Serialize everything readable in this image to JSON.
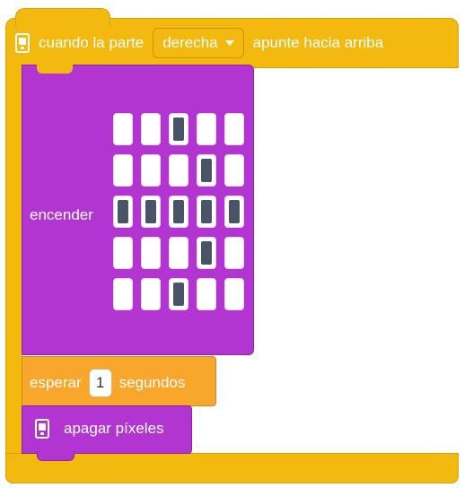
{
  "hat": {
    "label_prefix": "cuando la parte",
    "dropdown_value": "derecha",
    "label_suffix": "apunte hacia arriba",
    "icon": "hub-icon",
    "color": "#f3b90f"
  },
  "light_block": {
    "label": "encender",
    "color": "#b335d1",
    "matrix": [
      [
        0,
        0,
        1,
        0,
        0
      ],
      [
        0,
        0,
        0,
        1,
        0
      ],
      [
        1,
        1,
        1,
        1,
        1
      ],
      [
        0,
        0,
        0,
        1,
        0
      ],
      [
        0,
        0,
        1,
        0,
        0
      ]
    ]
  },
  "wait_block": {
    "label_prefix": "esperar",
    "value": "1",
    "label_suffix": "segundos",
    "color": "#f9a72c"
  },
  "clear_block": {
    "label": "apagar píxeles",
    "icon": "hub-icon",
    "color": "#b335d1"
  }
}
